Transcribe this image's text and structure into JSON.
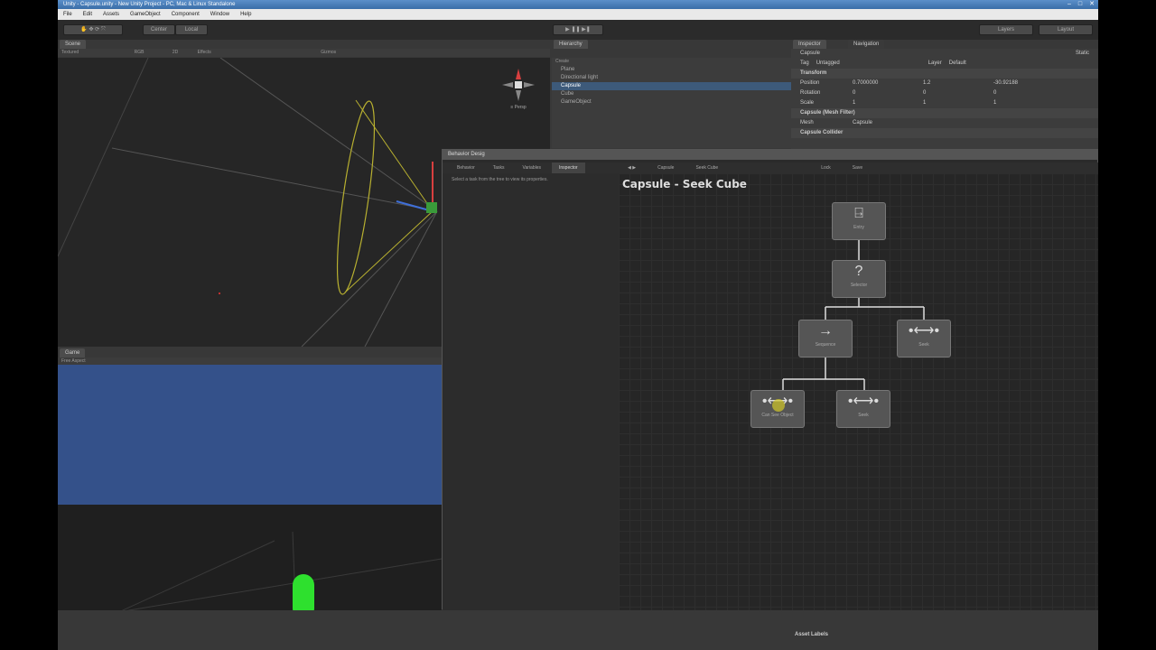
{
  "window": {
    "title": "Unity - Capsule.unity - New Unity Project - PC, Mac & Linux Standalone"
  },
  "menu": [
    "File",
    "Edit",
    "Assets",
    "GameObject",
    "Component",
    "Window",
    "Help"
  ],
  "toolbar": {
    "center": "Center",
    "local": "Local",
    "layers": "Layers",
    "layout": "Layout"
  },
  "scene": {
    "tab": "Scene",
    "mode": "Textured",
    "rgb": "RGB",
    "twod": "2D",
    "effects": "Effects",
    "gizmos": "Gizmos",
    "persp": "≡ Persp"
  },
  "game": {
    "tab": "Game",
    "aspect": "Free Aspect"
  },
  "hierarchy": {
    "tab": "Hierarchy",
    "create": "Create",
    "items": [
      "Plane",
      "Directional light",
      "Capsule",
      "Cube",
      "GameObject"
    ]
  },
  "inspector": {
    "tab": "Inspector",
    "nav_tab": "Navigation",
    "object": "Capsule",
    "static": "Static",
    "tag_label": "Tag",
    "tag": "Untagged",
    "layer_label": "Layer",
    "layer": "Default",
    "transform": "Transform",
    "position": {
      "label": "Position",
      "x": "0.7000000",
      "y": "1.2",
      "z": "-30.92188"
    },
    "rotation": {
      "label": "Rotation",
      "x": "0",
      "y": "0",
      "z": "0"
    },
    "scale": {
      "label": "Scale",
      "x": "1",
      "y": "1",
      "z": "1"
    },
    "mesh_filter": "Capsule (Mesh Filter)",
    "mesh_label": "Mesh",
    "mesh": "Capsule",
    "collider": "Capsule Collider"
  },
  "behavior": {
    "window_title": "Behavior Desig",
    "tabs": [
      "Behavior",
      "Tasks",
      "Variables",
      "Inspector"
    ],
    "hint": "Select a task from the tree to view its properties.",
    "graph_bar": [
      "Capsule",
      "Seek Cube",
      "Lock",
      "Save"
    ],
    "graph_title": "Capsule - Seek Cube",
    "nodes": [
      {
        "icon": "⍈",
        "label": "Entry"
      },
      {
        "icon": "?",
        "label": "Selector"
      },
      {
        "icon": "→",
        "label": "Sequence"
      },
      {
        "icon": "•⟷•",
        "label": "Seek"
      },
      {
        "icon": "•⟷•",
        "label": "Can See Object"
      },
      {
        "icon": "•⟷•",
        "label": "Seek"
      }
    ]
  },
  "footer": {
    "asset_labels": "Asset Labels"
  },
  "colors": {
    "game_sky": "#34518a",
    "capsule": "#2ee02e",
    "accent": "#3d5a7a"
  }
}
